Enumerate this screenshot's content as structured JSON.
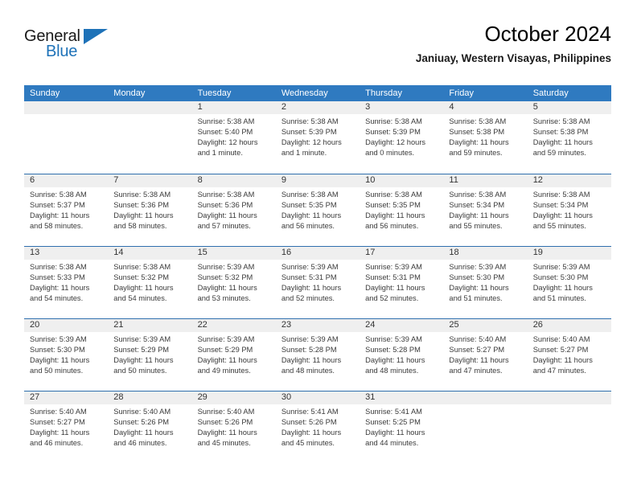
{
  "brand": {
    "name_part1": "General",
    "name_part2": "Blue",
    "accent_color": "#1e72b8"
  },
  "header": {
    "title": "October 2024",
    "subtitle": "Janiuay, Western Visayas, Philippines"
  },
  "calendar": {
    "header_bg": "#2f7ac0",
    "daystrip_bg": "#efefef",
    "separator_color": "#2f6fae",
    "day_names": [
      "Sunday",
      "Monday",
      "Tuesday",
      "Wednesday",
      "Thursday",
      "Friday",
      "Saturday"
    ],
    "weeks": [
      [
        {
          "day": "",
          "info": ""
        },
        {
          "day": "",
          "info": ""
        },
        {
          "day": "1",
          "info": "Sunrise: 5:38 AM\nSunset: 5:40 PM\nDaylight: 12 hours\nand 1 minute."
        },
        {
          "day": "2",
          "info": "Sunrise: 5:38 AM\nSunset: 5:39 PM\nDaylight: 12 hours\nand 1 minute."
        },
        {
          "day": "3",
          "info": "Sunrise: 5:38 AM\nSunset: 5:39 PM\nDaylight: 12 hours\nand 0 minutes."
        },
        {
          "day": "4",
          "info": "Sunrise: 5:38 AM\nSunset: 5:38 PM\nDaylight: 11 hours\nand 59 minutes."
        },
        {
          "day": "5",
          "info": "Sunrise: 5:38 AM\nSunset: 5:38 PM\nDaylight: 11 hours\nand 59 minutes."
        }
      ],
      [
        {
          "day": "6",
          "info": "Sunrise: 5:38 AM\nSunset: 5:37 PM\nDaylight: 11 hours\nand 58 minutes."
        },
        {
          "day": "7",
          "info": "Sunrise: 5:38 AM\nSunset: 5:36 PM\nDaylight: 11 hours\nand 58 minutes."
        },
        {
          "day": "8",
          "info": "Sunrise: 5:38 AM\nSunset: 5:36 PM\nDaylight: 11 hours\nand 57 minutes."
        },
        {
          "day": "9",
          "info": "Sunrise: 5:38 AM\nSunset: 5:35 PM\nDaylight: 11 hours\nand 56 minutes."
        },
        {
          "day": "10",
          "info": "Sunrise: 5:38 AM\nSunset: 5:35 PM\nDaylight: 11 hours\nand 56 minutes."
        },
        {
          "day": "11",
          "info": "Sunrise: 5:38 AM\nSunset: 5:34 PM\nDaylight: 11 hours\nand 55 minutes."
        },
        {
          "day": "12",
          "info": "Sunrise: 5:38 AM\nSunset: 5:34 PM\nDaylight: 11 hours\nand 55 minutes."
        }
      ],
      [
        {
          "day": "13",
          "info": "Sunrise: 5:38 AM\nSunset: 5:33 PM\nDaylight: 11 hours\nand 54 minutes."
        },
        {
          "day": "14",
          "info": "Sunrise: 5:38 AM\nSunset: 5:32 PM\nDaylight: 11 hours\nand 54 minutes."
        },
        {
          "day": "15",
          "info": "Sunrise: 5:39 AM\nSunset: 5:32 PM\nDaylight: 11 hours\nand 53 minutes."
        },
        {
          "day": "16",
          "info": "Sunrise: 5:39 AM\nSunset: 5:31 PM\nDaylight: 11 hours\nand 52 minutes."
        },
        {
          "day": "17",
          "info": "Sunrise: 5:39 AM\nSunset: 5:31 PM\nDaylight: 11 hours\nand 52 minutes."
        },
        {
          "day": "18",
          "info": "Sunrise: 5:39 AM\nSunset: 5:30 PM\nDaylight: 11 hours\nand 51 minutes."
        },
        {
          "day": "19",
          "info": "Sunrise: 5:39 AM\nSunset: 5:30 PM\nDaylight: 11 hours\nand 51 minutes."
        }
      ],
      [
        {
          "day": "20",
          "info": "Sunrise: 5:39 AM\nSunset: 5:30 PM\nDaylight: 11 hours\nand 50 minutes."
        },
        {
          "day": "21",
          "info": "Sunrise: 5:39 AM\nSunset: 5:29 PM\nDaylight: 11 hours\nand 50 minutes."
        },
        {
          "day": "22",
          "info": "Sunrise: 5:39 AM\nSunset: 5:29 PM\nDaylight: 11 hours\nand 49 minutes."
        },
        {
          "day": "23",
          "info": "Sunrise: 5:39 AM\nSunset: 5:28 PM\nDaylight: 11 hours\nand 48 minutes."
        },
        {
          "day": "24",
          "info": "Sunrise: 5:39 AM\nSunset: 5:28 PM\nDaylight: 11 hours\nand 48 minutes."
        },
        {
          "day": "25",
          "info": "Sunrise: 5:40 AM\nSunset: 5:27 PM\nDaylight: 11 hours\nand 47 minutes."
        },
        {
          "day": "26",
          "info": "Sunrise: 5:40 AM\nSunset: 5:27 PM\nDaylight: 11 hours\nand 47 minutes."
        }
      ],
      [
        {
          "day": "27",
          "info": "Sunrise: 5:40 AM\nSunset: 5:27 PM\nDaylight: 11 hours\nand 46 minutes."
        },
        {
          "day": "28",
          "info": "Sunrise: 5:40 AM\nSunset: 5:26 PM\nDaylight: 11 hours\nand 46 minutes."
        },
        {
          "day": "29",
          "info": "Sunrise: 5:40 AM\nSunset: 5:26 PM\nDaylight: 11 hours\nand 45 minutes."
        },
        {
          "day": "30",
          "info": "Sunrise: 5:41 AM\nSunset: 5:26 PM\nDaylight: 11 hours\nand 45 minutes."
        },
        {
          "day": "31",
          "info": "Sunrise: 5:41 AM\nSunset: 5:25 PM\nDaylight: 11 hours\nand 44 minutes."
        },
        {
          "day": "",
          "info": ""
        },
        {
          "day": "",
          "info": ""
        }
      ]
    ]
  }
}
